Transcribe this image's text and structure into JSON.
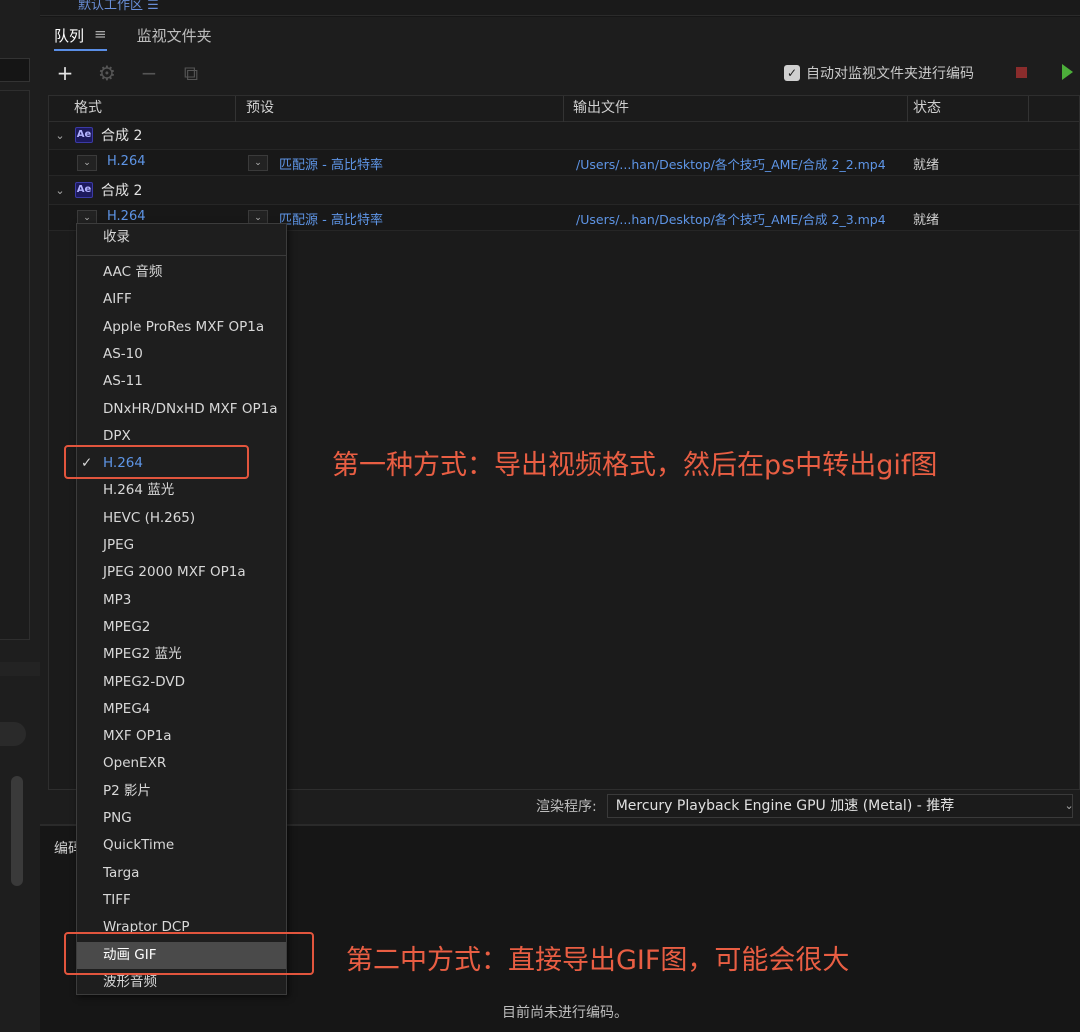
{
  "topbar": {
    "tab_label": "默认工作区 ☰"
  },
  "tabs": {
    "queue": "队列",
    "queue_menu": "≡",
    "watch_folder": "监视文件夹"
  },
  "toolbar": {
    "add": "+",
    "settings": "⚙",
    "remove": "−",
    "duplicate": "⧉"
  },
  "auto_encode": {
    "checked": true,
    "label": "自动对监视文件夹进行编码"
  },
  "columns": {
    "format": "格式",
    "preset": "预设",
    "output": "输出文件",
    "status": "状态"
  },
  "queue": [
    {
      "app_icon": "Ae",
      "name": "合成 2",
      "format": "H.264",
      "preset": "匹配源 - 高比特率",
      "output": "/Users/...han/Desktop/各个技巧_AME/合成 2_2.mp4",
      "status": "就绪"
    },
    {
      "app_icon": "Ae",
      "name": "合成 2",
      "format": "H.264",
      "preset": "匹配源 - 高比特率",
      "output": "/Users/...han/Desktop/各个技巧_AME/合成 2_3.mp4",
      "status": "就绪"
    }
  ],
  "dropdown": {
    "favorites": "收录",
    "items": [
      "AAC 音频",
      "AIFF",
      "Apple ProRes MXF OP1a",
      "AS-10",
      "AS-11",
      "DNxHR/DNxHD MXF OP1a",
      "DPX",
      "H.264",
      "H.264 蓝光",
      "HEVC (H.265)",
      "JPEG",
      "JPEG 2000 MXF OP1a",
      "MP3",
      "MPEG2",
      "MPEG2 蓝光",
      "MPEG2-DVD",
      "MPEG4",
      "MXF OP1a",
      "OpenEXR",
      "P2 影片",
      "PNG",
      "QuickTime",
      "Targa",
      "TIFF",
      "Wraptor DCP",
      "动画 GIF",
      "波形音频"
    ],
    "selected": "H.264",
    "highlighted": "动画 GIF"
  },
  "renderer": {
    "label": "渲染程序:",
    "value": "Mercury Playback Engine GPU 加速 (Metal) - 推荐"
  },
  "encoding": {
    "title": "编码",
    "message": "目前尚未进行编码。"
  },
  "annotations": {
    "note1": "第一种方式：导出视频格式，然后在ps中转出gif图",
    "note2": "第二中方式：直接导出GIF图，可能会很大",
    "color": "#e2553d"
  }
}
